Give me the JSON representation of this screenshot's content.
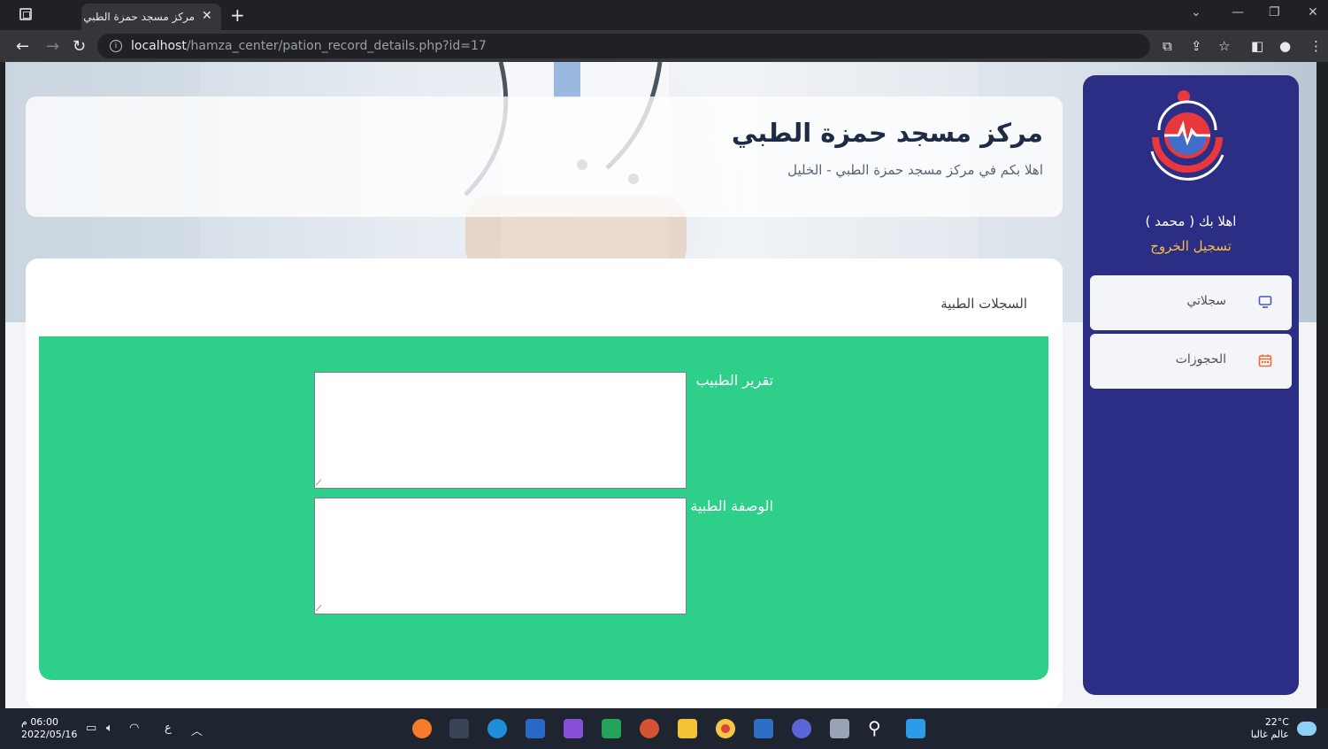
{
  "browser": {
    "tab_title": "مركز مسجد حمزة الطبي",
    "tab_close": "✕",
    "new_tab": "+",
    "url_host": "localhost",
    "url_path": "/hamza_center/pation_record_details.php?id=17"
  },
  "header": {
    "title": "مركز مسجد حمزة الطبي",
    "subtitle": "اهلا بكم في مركز مسجد حمزة الطبي - الخليل"
  },
  "section": {
    "title": "السجلات الطبية"
  },
  "form": {
    "doctor_report_label": "تقرير الطبيب",
    "doctor_report_value": "",
    "prescription_label": "الوصفة الطبية",
    "prescription_value": ""
  },
  "sidebar": {
    "welcome": "اهلا بك ( محمد )",
    "logout": "تسجيل الخروج",
    "items": [
      {
        "label": "سجلاتي",
        "icon": "monitor-icon"
      },
      {
        "label": "الحجوزات",
        "icon": "calendar-icon"
      }
    ]
  },
  "taskbar": {
    "time": "06:00 م",
    "date": "2022/05/16",
    "lang": "ع",
    "temp": "22°C",
    "weather_text": "عالم غالبا"
  },
  "colors": {
    "sidebar": "#2b2e84",
    "panel": "#2ecf8b",
    "logout": "#f5c043"
  }
}
